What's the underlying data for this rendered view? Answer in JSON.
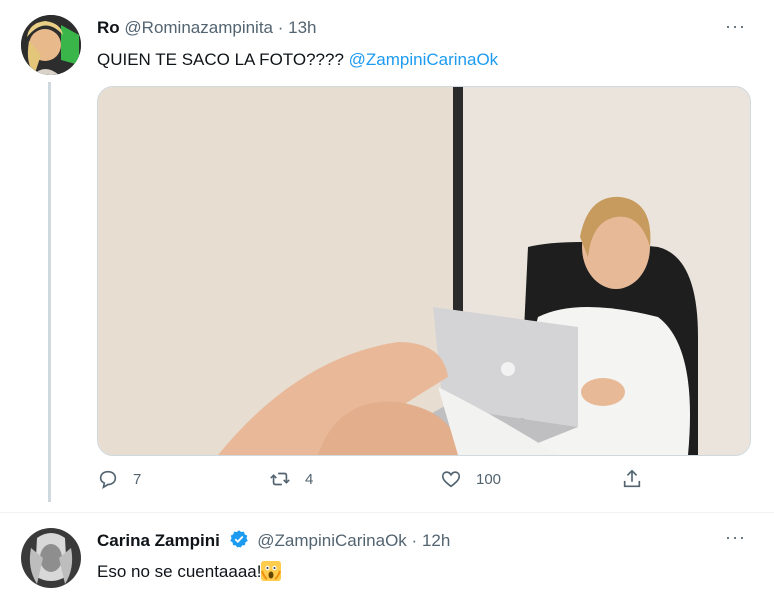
{
  "tweet1": {
    "display_name": "Ro",
    "handle": "@Rominazampinita",
    "separator": "·",
    "time": "13h",
    "text": "QUIEN TE SACO LA FOTO????",
    "mention": "@ZampiniCarinaOk",
    "actions": {
      "reply_count": "7",
      "retweet_count": "4",
      "like_count": "100"
    }
  },
  "tweet2": {
    "display_name": "Carina Zampini",
    "handle": "@ZampiniCarinaOk",
    "separator": "·",
    "time": "12h",
    "text": "Eso no se cuentaaaa!",
    "emoji": "screaming-face-emoji"
  },
  "more_label": "···",
  "colors": {
    "accent": "#1d9bf0",
    "muted": "#536471",
    "thread_line": "#cfd9de",
    "verified": "#1d9bf0"
  }
}
